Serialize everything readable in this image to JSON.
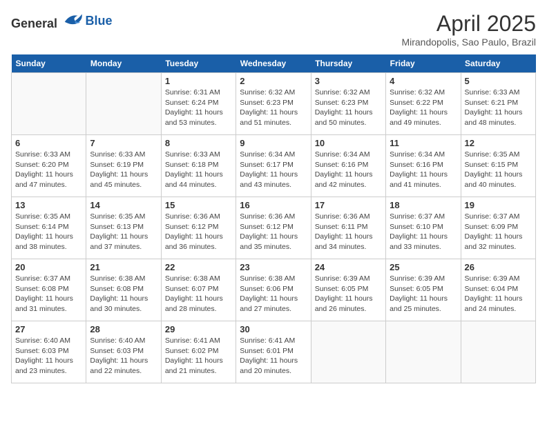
{
  "logo": {
    "general": "General",
    "blue": "Blue"
  },
  "title": "April 2025",
  "subtitle": "Mirandopolis, Sao Paulo, Brazil",
  "weekdays": [
    "Sunday",
    "Monday",
    "Tuesday",
    "Wednesday",
    "Thursday",
    "Friday",
    "Saturday"
  ],
  "weeks": [
    [
      {
        "day": "",
        "info": ""
      },
      {
        "day": "",
        "info": ""
      },
      {
        "day": "1",
        "info": "Sunrise: 6:31 AM\nSunset: 6:24 PM\nDaylight: 11 hours and 53 minutes."
      },
      {
        "day": "2",
        "info": "Sunrise: 6:32 AM\nSunset: 6:23 PM\nDaylight: 11 hours and 51 minutes."
      },
      {
        "day": "3",
        "info": "Sunrise: 6:32 AM\nSunset: 6:23 PM\nDaylight: 11 hours and 50 minutes."
      },
      {
        "day": "4",
        "info": "Sunrise: 6:32 AM\nSunset: 6:22 PM\nDaylight: 11 hours and 49 minutes."
      },
      {
        "day": "5",
        "info": "Sunrise: 6:33 AM\nSunset: 6:21 PM\nDaylight: 11 hours and 48 minutes."
      }
    ],
    [
      {
        "day": "6",
        "info": "Sunrise: 6:33 AM\nSunset: 6:20 PM\nDaylight: 11 hours and 47 minutes."
      },
      {
        "day": "7",
        "info": "Sunrise: 6:33 AM\nSunset: 6:19 PM\nDaylight: 11 hours and 45 minutes."
      },
      {
        "day": "8",
        "info": "Sunrise: 6:33 AM\nSunset: 6:18 PM\nDaylight: 11 hours and 44 minutes."
      },
      {
        "day": "9",
        "info": "Sunrise: 6:34 AM\nSunset: 6:17 PM\nDaylight: 11 hours and 43 minutes."
      },
      {
        "day": "10",
        "info": "Sunrise: 6:34 AM\nSunset: 6:16 PM\nDaylight: 11 hours and 42 minutes."
      },
      {
        "day": "11",
        "info": "Sunrise: 6:34 AM\nSunset: 6:16 PM\nDaylight: 11 hours and 41 minutes."
      },
      {
        "day": "12",
        "info": "Sunrise: 6:35 AM\nSunset: 6:15 PM\nDaylight: 11 hours and 40 minutes."
      }
    ],
    [
      {
        "day": "13",
        "info": "Sunrise: 6:35 AM\nSunset: 6:14 PM\nDaylight: 11 hours and 38 minutes."
      },
      {
        "day": "14",
        "info": "Sunrise: 6:35 AM\nSunset: 6:13 PM\nDaylight: 11 hours and 37 minutes."
      },
      {
        "day": "15",
        "info": "Sunrise: 6:36 AM\nSunset: 6:12 PM\nDaylight: 11 hours and 36 minutes."
      },
      {
        "day": "16",
        "info": "Sunrise: 6:36 AM\nSunset: 6:12 PM\nDaylight: 11 hours and 35 minutes."
      },
      {
        "day": "17",
        "info": "Sunrise: 6:36 AM\nSunset: 6:11 PM\nDaylight: 11 hours and 34 minutes."
      },
      {
        "day": "18",
        "info": "Sunrise: 6:37 AM\nSunset: 6:10 PM\nDaylight: 11 hours and 33 minutes."
      },
      {
        "day": "19",
        "info": "Sunrise: 6:37 AM\nSunset: 6:09 PM\nDaylight: 11 hours and 32 minutes."
      }
    ],
    [
      {
        "day": "20",
        "info": "Sunrise: 6:37 AM\nSunset: 6:08 PM\nDaylight: 11 hours and 31 minutes."
      },
      {
        "day": "21",
        "info": "Sunrise: 6:38 AM\nSunset: 6:08 PM\nDaylight: 11 hours and 30 minutes."
      },
      {
        "day": "22",
        "info": "Sunrise: 6:38 AM\nSunset: 6:07 PM\nDaylight: 11 hours and 28 minutes."
      },
      {
        "day": "23",
        "info": "Sunrise: 6:38 AM\nSunset: 6:06 PM\nDaylight: 11 hours and 27 minutes."
      },
      {
        "day": "24",
        "info": "Sunrise: 6:39 AM\nSunset: 6:05 PM\nDaylight: 11 hours and 26 minutes."
      },
      {
        "day": "25",
        "info": "Sunrise: 6:39 AM\nSunset: 6:05 PM\nDaylight: 11 hours and 25 minutes."
      },
      {
        "day": "26",
        "info": "Sunrise: 6:39 AM\nSunset: 6:04 PM\nDaylight: 11 hours and 24 minutes."
      }
    ],
    [
      {
        "day": "27",
        "info": "Sunrise: 6:40 AM\nSunset: 6:03 PM\nDaylight: 11 hours and 23 minutes."
      },
      {
        "day": "28",
        "info": "Sunrise: 6:40 AM\nSunset: 6:03 PM\nDaylight: 11 hours and 22 minutes."
      },
      {
        "day": "29",
        "info": "Sunrise: 6:41 AM\nSunset: 6:02 PM\nDaylight: 11 hours and 21 minutes."
      },
      {
        "day": "30",
        "info": "Sunrise: 6:41 AM\nSunset: 6:01 PM\nDaylight: 11 hours and 20 minutes."
      },
      {
        "day": "",
        "info": ""
      },
      {
        "day": "",
        "info": ""
      },
      {
        "day": "",
        "info": ""
      }
    ]
  ]
}
